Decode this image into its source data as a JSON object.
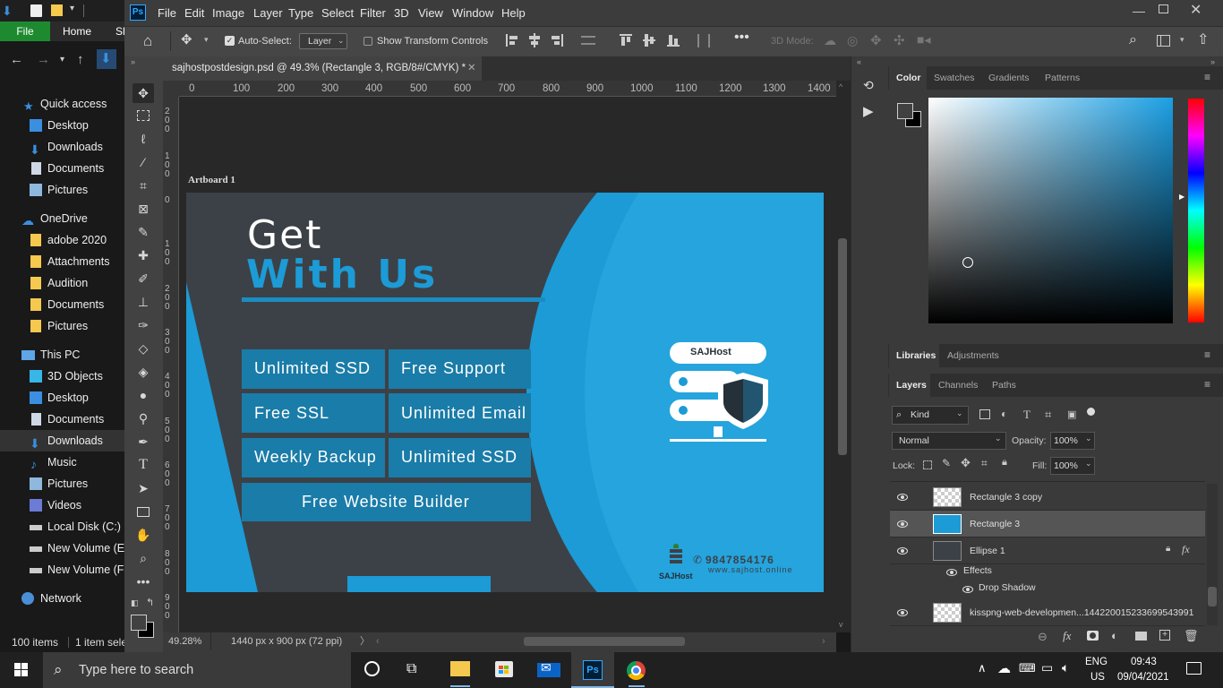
{
  "explorer": {
    "ribbon_tabs": [
      "File",
      "Home",
      "Sh"
    ],
    "quick_access": "Quick access",
    "items": [
      {
        "label": "Desktop",
        "icon": "desktop-icon"
      },
      {
        "label": "Downloads",
        "icon": "download-icon"
      },
      {
        "label": "Documents",
        "icon": "document-icon"
      },
      {
        "label": "Pictures",
        "icon": "pictures-icon"
      }
    ],
    "onedrive": "OneDrive",
    "onedrive_items": [
      "adobe 2020",
      "Attachments",
      "Audition",
      "Documents",
      "Pictures"
    ],
    "this_pc": "This PC",
    "pc_items": [
      "3D Objects",
      "Desktop",
      "Documents",
      "Downloads",
      "Music",
      "Pictures",
      "Videos",
      "Local Disk (C:)",
      "New Volume (E:",
      "New Volume (F:"
    ],
    "network": "Network",
    "status_count": "100 items",
    "status_selected": "1 item sele"
  },
  "menubar": {
    "items": [
      "File",
      "Edit",
      "Image",
      "Layer",
      "Type",
      "Select",
      "Filter",
      "3D",
      "View",
      "Window",
      "Help"
    ]
  },
  "options": {
    "auto_select": "Auto-Select:",
    "layer_select": "Layer",
    "show_transform": "Show Transform Controls",
    "mode_3d": "3D Mode:"
  },
  "document": {
    "tab_title": "sajhostpostdesign.psd @ 49.3% (Rectangle 3, RGB/8#/CMYK) *",
    "ruler_h": [
      "0",
      "100",
      "200",
      "300",
      "400",
      "500",
      "600",
      "700",
      "800",
      "900",
      "1000",
      "1100",
      "1200",
      "1300",
      "1400"
    ],
    "ruler_v": [
      "2\n0\n0",
      "1\n0\n0",
      "0",
      "1\n0\n0",
      "2\n0\n0",
      "3\n0\n0",
      "4\n0\n0",
      "5\n0\n0",
      "6\n0\n0",
      "7\n0\n0",
      "8\n0\n0",
      "9\n0\n0"
    ],
    "artboard_label": "Artboard 1",
    "zoom": "49.28%",
    "dimensions": "1440 px x 900 px (72 ppi)"
  },
  "design": {
    "headline_1": "Get",
    "headline_2": "With Us",
    "features": [
      "Unlimited SSD",
      "Free Support",
      "Free SSL",
      "Unlimited Email",
      "Weekly Backup",
      "Unlimited SSD"
    ],
    "feature_wide": "Free Website Builder",
    "logo_text": "SAJHost",
    "phone": "9847854176",
    "website": "www.sajhost.online",
    "footer_logo": "SAJHost",
    "colors": {
      "accent": "#1c9bd6",
      "dark": "#3c4147",
      "box": "#1a7ca8"
    }
  },
  "color_panel": {
    "tabs": [
      "Color",
      "Swatches",
      "Gradients",
      "Patterns"
    ]
  },
  "libraries_panel": {
    "tabs": [
      "Libraries",
      "Adjustments"
    ]
  },
  "layers_panel": {
    "tabs": [
      "Layers",
      "Channels",
      "Paths"
    ],
    "filter_kind": "Kind",
    "blend_mode": "Normal",
    "opacity_label": "Opacity:",
    "opacity_value": "100%",
    "lock_label": "Lock:",
    "fill_label": "Fill:",
    "fill_value": "100%",
    "layers": [
      {
        "name": "Rectangle 3 copy",
        "selected": false
      },
      {
        "name": "Rectangle 3",
        "selected": true
      },
      {
        "name": "Ellipse 1",
        "selected": false,
        "effects_label": "Effects",
        "effect": "Drop Shadow"
      },
      {
        "name": "kisspng-web-developmen...144220015233699543991",
        "selected": false
      }
    ]
  },
  "taskbar": {
    "search_placeholder": "Type here to search",
    "lang_1": "ENG",
    "lang_2": "US",
    "time": "09:43",
    "date": "09/04/2021"
  }
}
